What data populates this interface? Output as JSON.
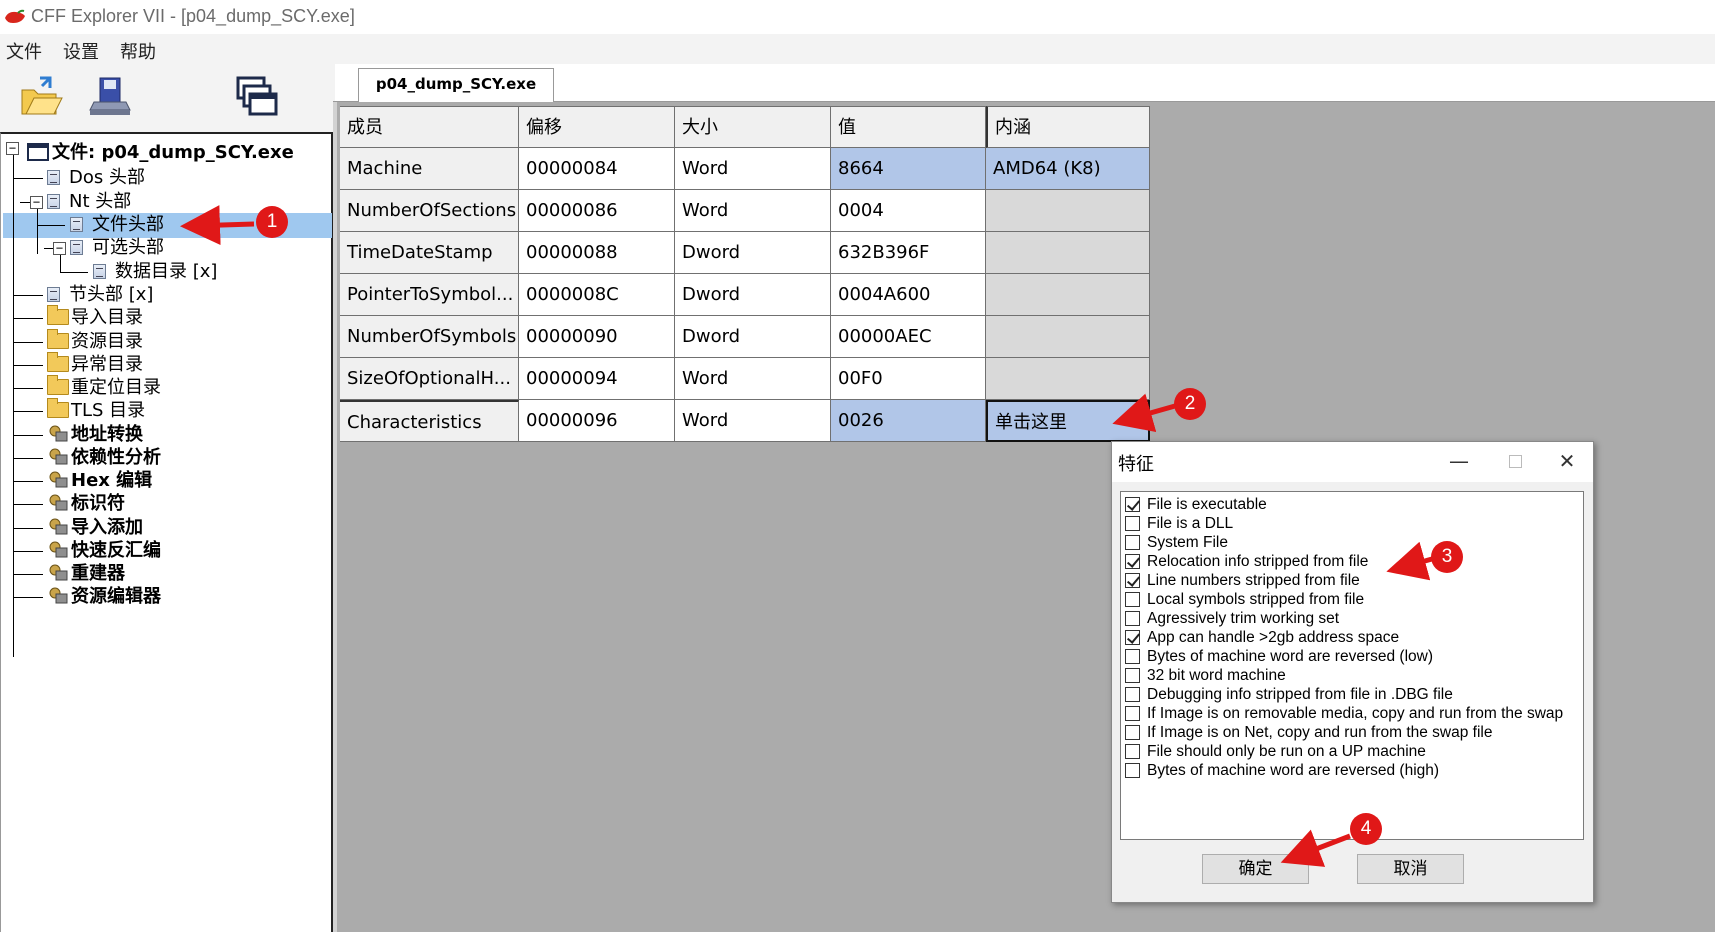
{
  "window": {
    "title": "CFF Explorer VII - [p04_dump_SCY.exe]"
  },
  "menu": {
    "items": [
      "文件",
      "设置",
      "帮助"
    ]
  },
  "toolbar": {
    "buttons": [
      "open-icon",
      "save-icon",
      "windows-icon"
    ]
  },
  "tree": {
    "root": "文件: p04_dump_SCY.exe",
    "items": [
      {
        "label": "Dos 头部",
        "icon": "doc"
      },
      {
        "label": "Nt 头部",
        "icon": "doc"
      },
      {
        "label": "文件头部",
        "icon": "doc",
        "selected": true
      },
      {
        "label": "可选头部",
        "icon": "doc"
      },
      {
        "label": "数据目录 [x]",
        "icon": "doc"
      },
      {
        "label": "节头部 [x]",
        "icon": "doc"
      },
      {
        "label": "导入目录",
        "icon": "folder"
      },
      {
        "label": "资源目录",
        "icon": "folder"
      },
      {
        "label": "异常目录",
        "icon": "folder"
      },
      {
        "label": "重定位目录",
        "icon": "folder"
      },
      {
        "label": "TLS 目录",
        "icon": "folder"
      },
      {
        "label": "地址转换",
        "icon": "tool"
      },
      {
        "label": "依赖性分析",
        "icon": "tool"
      },
      {
        "label": "Hex 编辑",
        "icon": "tool"
      },
      {
        "label": "标识符",
        "icon": "tool"
      },
      {
        "label": "导入添加",
        "icon": "tool"
      },
      {
        "label": "快速反汇编",
        "icon": "tool"
      },
      {
        "label": "重建器",
        "icon": "tool"
      },
      {
        "label": "资源编辑器",
        "icon": "tool"
      }
    ]
  },
  "tab": {
    "label": "p04_dump_SCY.exe"
  },
  "table": {
    "columns": [
      "成员",
      "偏移",
      "大小",
      "值",
      "内涵"
    ],
    "rows": [
      [
        "Machine",
        "00000084",
        "Word",
        "8664",
        "AMD64 (K8)"
      ],
      [
        "NumberOfSections",
        "00000086",
        "Word",
        "0004",
        ""
      ],
      [
        "TimeDateStamp",
        "00000088",
        "Dword",
        "632B396F",
        ""
      ],
      [
        "PointerToSymbol...",
        "0000008C",
        "Dword",
        "0004A600",
        ""
      ],
      [
        "NumberOfSymbols",
        "00000090",
        "Dword",
        "00000AEC",
        ""
      ],
      [
        "SizeOfOptionalH...",
        "00000094",
        "Word",
        "00F0",
        ""
      ],
      [
        "Characteristics",
        "00000096",
        "Word",
        "0026",
        "单击这里"
      ]
    ]
  },
  "dialog": {
    "title": "特征",
    "options": [
      {
        "label": "File is executable",
        "checked": true
      },
      {
        "label": "File is a DLL",
        "checked": false
      },
      {
        "label": "System File",
        "checked": false
      },
      {
        "label": "Relocation info stripped from file",
        "checked": true
      },
      {
        "label": "Line numbers stripped from file",
        "checked": true
      },
      {
        "label": "Local symbols stripped from file",
        "checked": false
      },
      {
        "label": "Agressively trim working set",
        "checked": false
      },
      {
        "label": "App can handle >2gb address space",
        "checked": true
      },
      {
        "label": "Bytes of machine word are reversed (low)",
        "checked": false
      },
      {
        "label": "32 bit word machine",
        "checked": false
      },
      {
        "label": "Debugging info stripped from file in .DBG file",
        "checked": false
      },
      {
        "label": "If Image is on removable media, copy and run from the swap",
        "checked": false
      },
      {
        "label": "If Image is on Net, copy and run from the swap file",
        "checked": false
      },
      {
        "label": "File should only be run on a UP machine",
        "checked": false
      },
      {
        "label": "Bytes of machine word are reversed (high)",
        "checked": false
      }
    ],
    "ok_label": "确定",
    "cancel_label": "取消"
  },
  "annotations": [
    "1",
    "2",
    "3",
    "4"
  ],
  "colors": {
    "annotation": "#e01818",
    "selection": "#9fc8ef",
    "value_highlight": "#b1c6e8"
  }
}
